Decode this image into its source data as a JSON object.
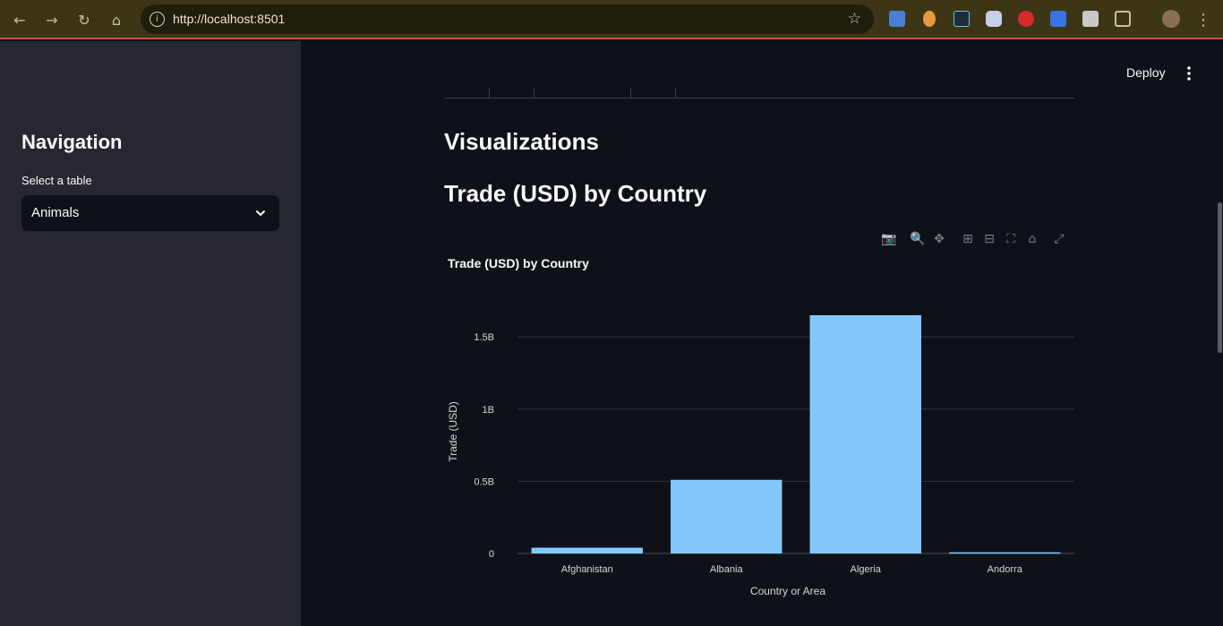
{
  "browser": {
    "url": "http://localhost:8501",
    "chrome_color": "#3c3516"
  },
  "sidebar": {
    "title": "Navigation",
    "select_label": "Select a table",
    "select_value": "Animals"
  },
  "header": {
    "deploy_label": "Deploy"
  },
  "main": {
    "section_heading": "Visualizations",
    "chart_heading": "Trade (USD) by Country"
  },
  "modebar": {
    "icons": [
      "camera-icon",
      "zoom-icon",
      "pan-icon",
      "zoom-in-icon",
      "zoom-out-icon",
      "autoscale-icon",
      "reset-axes-icon",
      "fullscreen-icon"
    ]
  },
  "chart_data": {
    "type": "bar",
    "title": "Trade (USD) by Country",
    "xlabel": "Country or Area",
    "ylabel": "Trade (USD)",
    "categories": [
      "Afghanistan",
      "Albania",
      "Algeria",
      "Andorra"
    ],
    "values": [
      40000000,
      510000000,
      1650000000,
      8000000
    ],
    "ylim": [
      0,
      1650000000
    ],
    "yticks": [
      {
        "value": 0,
        "label": "0"
      },
      {
        "value": 500000000,
        "label": "0.5B"
      },
      {
        "value": 1000000000,
        "label": "1B"
      },
      {
        "value": 1500000000,
        "label": "1.5B"
      }
    ],
    "bar_color": "#83c9ff",
    "grid": true
  }
}
